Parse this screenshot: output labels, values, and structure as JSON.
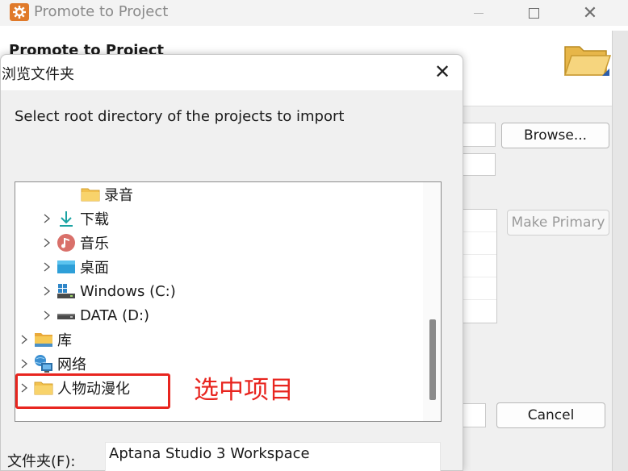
{
  "background_window": {
    "title": "Promote to Project",
    "heading": "Promote to Project",
    "browse_button": "Browse...",
    "make_primary_button": "Make Primary",
    "cancel_button": "Cancel"
  },
  "dialog": {
    "title": "浏览文件夹",
    "instruction": "Select root directory of the projects to import",
    "tree": {
      "items": [
        {
          "label": "录音",
          "icon": "folder-icon",
          "expandable": false
        },
        {
          "label": "下载",
          "icon": "download-icon",
          "expandable": true
        },
        {
          "label": "音乐",
          "icon": "music-icon",
          "expandable": true
        },
        {
          "label": "桌面",
          "icon": "desktop-icon",
          "expandable": true
        },
        {
          "label": "Windows (C:)",
          "icon": "windows-drive-icon",
          "expandable": true
        },
        {
          "label": "DATA (D:)",
          "icon": "drive-icon",
          "expandable": true
        },
        {
          "label": "库",
          "icon": "library-folder-icon",
          "expandable": true
        },
        {
          "label": "网络",
          "icon": "network-icon",
          "expandable": true
        },
        {
          "label": "人物动漫化",
          "icon": "folder-icon",
          "expandable": true
        }
      ]
    },
    "folder_label": "文件夹(F):",
    "folder_value": "Aptana Studio 3 Workspace"
  },
  "annotation": {
    "text": "选中项目",
    "color": "#e8251f"
  }
}
